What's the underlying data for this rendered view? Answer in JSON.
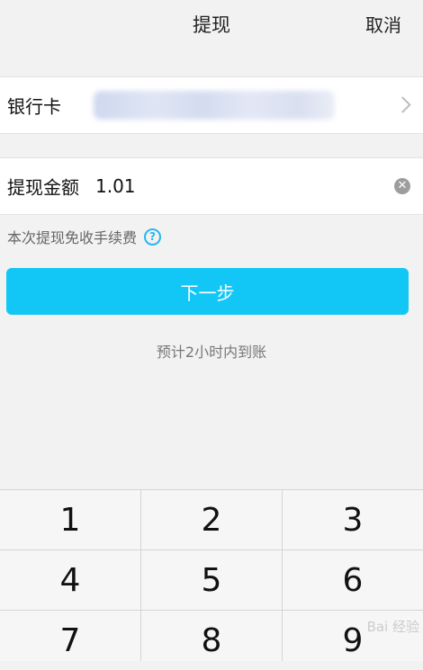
{
  "nav": {
    "title": "提现",
    "cancel": "取消"
  },
  "bank_card": {
    "label": "银行卡"
  },
  "amount": {
    "label": "提现金额",
    "value": "1.01"
  },
  "fee_note": "本次提现免收手续费",
  "next_button": "下一步",
  "eta": "预计2小时内到账",
  "keypad": {
    "keys": [
      "1",
      "2",
      "3",
      "4",
      "5",
      "6",
      "7",
      "8",
      "9"
    ]
  },
  "watermark": "Bai 经验"
}
